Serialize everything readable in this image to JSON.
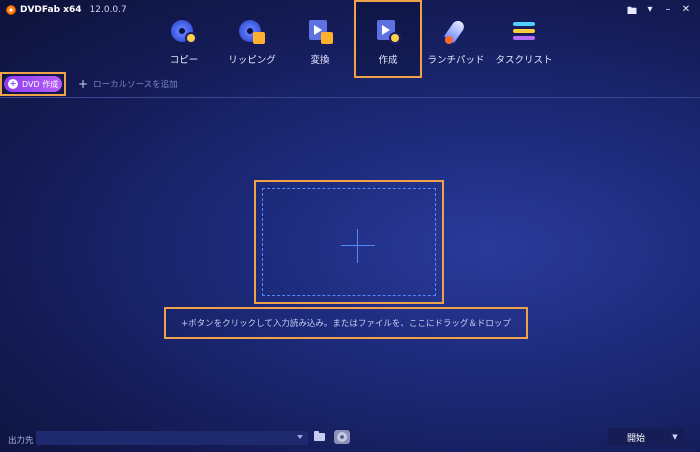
{
  "app": {
    "name": "DVDFab x64",
    "version": "12.0.0.7"
  },
  "window_controls": {
    "icons": [
      "gift-icon",
      "dropdown-icon",
      "minimize-icon",
      "close-icon"
    ]
  },
  "tabs": [
    {
      "label": "コピー",
      "icon": "copy-disc-icon"
    },
    {
      "label": "リッピング",
      "icon": "ripper-disc-icon"
    },
    {
      "label": "変換",
      "icon": "convert-film-icon"
    },
    {
      "label": "作成",
      "icon": "creator-film-icon",
      "active": true
    },
    {
      "label": "ランチパッド",
      "icon": "rocket-icon"
    },
    {
      "label": "タスクリスト",
      "icon": "task-list-icon"
    }
  ],
  "secondary_bar": {
    "dvd_button_label": "DVD 作成",
    "add_local_label": "ローカルソースを追加"
  },
  "drop_area": {
    "hint": "+ボタンをクリックして入力読み込み。またはファイルを、ここにドラッグ＆ドロップ"
  },
  "footer": {
    "output_label": "出力先",
    "output_value": "",
    "start_label": "開始"
  },
  "colors": {
    "accent": "#f0a24b",
    "purple": "#9a48f4",
    "dashed": "#4f8bff"
  }
}
